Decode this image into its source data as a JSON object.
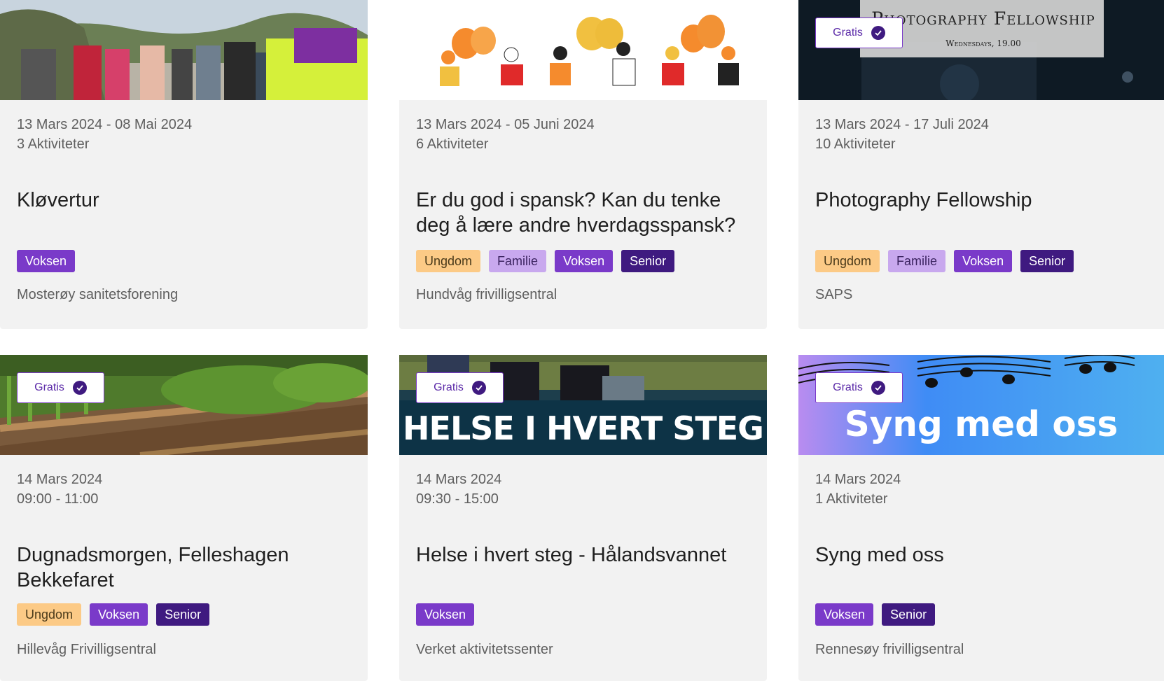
{
  "gratis_label": "Gratis",
  "cards": [
    {
      "dates": "13 Mars 2024 - 08 Mai 2024",
      "sub": "3  Aktiviteter",
      "title": "Kløvertur",
      "tags": [
        "Voksen"
      ],
      "org": "Mosterøy sanitetsforening"
    },
    {
      "dates": "13 Mars 2024 - 05 Juni 2024",
      "sub": "6  Aktiviteter",
      "title": "Er du god i spansk? Kan du tenke deg å lære andre hverdagsspansk?",
      "tags": [
        "Ungdom",
        "Familie",
        "Voksen",
        "Senior"
      ],
      "org": "Hundvåg frivilligsentral"
    },
    {
      "dates": "13 Mars 2024 - 17 Juli 2024",
      "sub": "10  Aktiviteter",
      "title": "Photography Fellowship",
      "tags": [
        "Ungdom",
        "Familie",
        "Voksen",
        "Senior"
      ],
      "org": "SAPS",
      "banner_title": "Photography Fellowship",
      "banner_sub": "Wednesdays, 19.00"
    },
    {
      "dates": "14 Mars 2024",
      "sub": "09:00 - 11:00",
      "title": "Dugnadsmorgen, Felleshagen Bekkefaret",
      "tags": [
        "Ungdom",
        "Voksen",
        "Senior"
      ],
      "org": "Hillevåg Frivilligsentral"
    },
    {
      "dates": "14 Mars 2024",
      "sub": "09:30 - 15:00",
      "title": "Helse i hvert steg - Hålandsvannet",
      "tags": [
        "Voksen"
      ],
      "org": "Verket aktivitetssenter",
      "banner_title": "HELSE I HVERT STEG"
    },
    {
      "dates": "14 Mars 2024",
      "sub": "1  Aktiviteter",
      "title": "Syng med oss",
      "tags": [
        "Voksen",
        "Senior"
      ],
      "org": "Rennesøy frivilligsentral",
      "banner_title": "Syng med oss"
    }
  ]
}
